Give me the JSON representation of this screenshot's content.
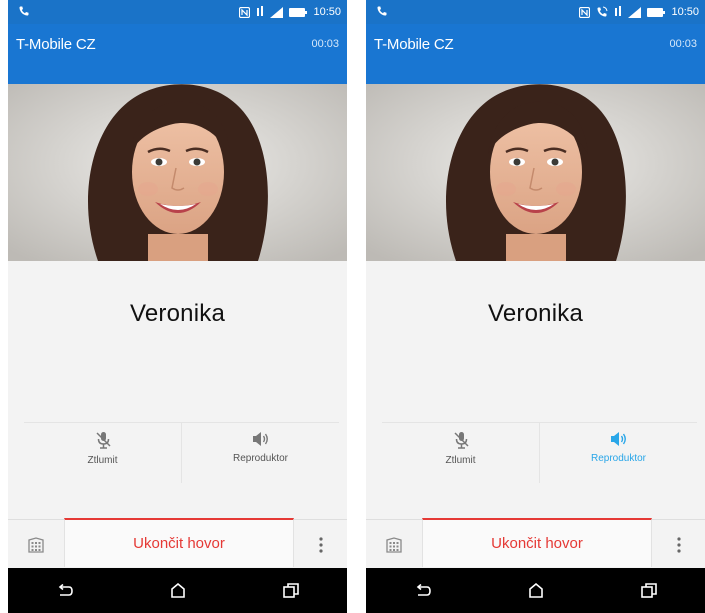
{
  "screens": [
    {
      "status": {
        "time": "10:50"
      },
      "header": {
        "carrier": "T-Mobile CZ",
        "duration": "00:03"
      },
      "caller": {
        "name": "Veronika"
      },
      "controls": {
        "mute_label": "Ztlumit",
        "speaker_label": "Reproduktor",
        "speaker_active": false
      },
      "end_call_label": "Ukončit hovor"
    },
    {
      "status": {
        "time": "10:50"
      },
      "header": {
        "carrier": "T-Mobile CZ",
        "duration": "00:03"
      },
      "caller": {
        "name": "Veronika"
      },
      "controls": {
        "mute_label": "Ztlumit",
        "speaker_label": "Reproduktor",
        "speaker_active": true
      },
      "end_call_label": "Ukončit hovor"
    }
  ],
  "icons": {
    "status_left": "phone-icon",
    "status_right": [
      "nfc-icon",
      "call-forward-icon",
      "signal-icon",
      "battery-icon"
    ],
    "controls": [
      "mute-mic-icon",
      "speaker-icon"
    ],
    "bottom": [
      "dialpad-icon",
      "more-vert-icon"
    ],
    "nav": [
      "back-icon",
      "home-icon",
      "recents-icon"
    ]
  },
  "colors": {
    "status_bar": "#1a73c8",
    "header": "#1976d2",
    "end_call": "#e53935",
    "active_control": "#29a6e8",
    "inactive_control": "#777777"
  }
}
